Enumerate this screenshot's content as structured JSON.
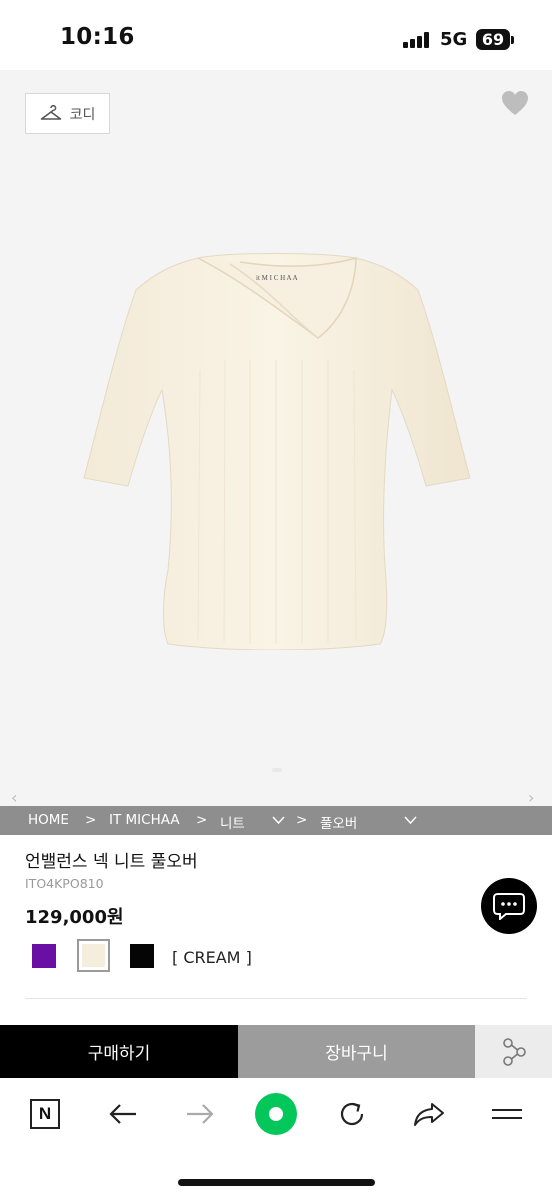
{
  "status_bar": {
    "time": "10:16",
    "network": "5G",
    "battery": "69"
  },
  "image_area": {
    "codi_label": "코디"
  },
  "breadcrumb": {
    "home": "HOME",
    "sep1": ">",
    "brand": "IT MICHAA",
    "sep2": ">",
    "category": "니트",
    "sep3": ">",
    "subcategory": "풀오버"
  },
  "product": {
    "name": "언밸런스 넥 니트 풀오버",
    "code": "ITO4KPO810",
    "price": "129,000원",
    "colors": [
      {
        "name": "purple",
        "hex": "#6a0fa3"
      },
      {
        "name": "cream",
        "hex": "#f5eedc",
        "selected": true
      },
      {
        "name": "black",
        "hex": "#050505"
      }
    ],
    "selected_color_label": "[ CREAM ]"
  },
  "actions": {
    "buy_label": "구매하기",
    "cart_label": "장바구니"
  },
  "browser_toolbar": {
    "icons": [
      "naver-n-icon",
      "back-arrow-icon",
      "forward-arrow-icon",
      "green-home-icon",
      "refresh-icon",
      "share-arrow-icon",
      "menu-icon"
    ]
  }
}
